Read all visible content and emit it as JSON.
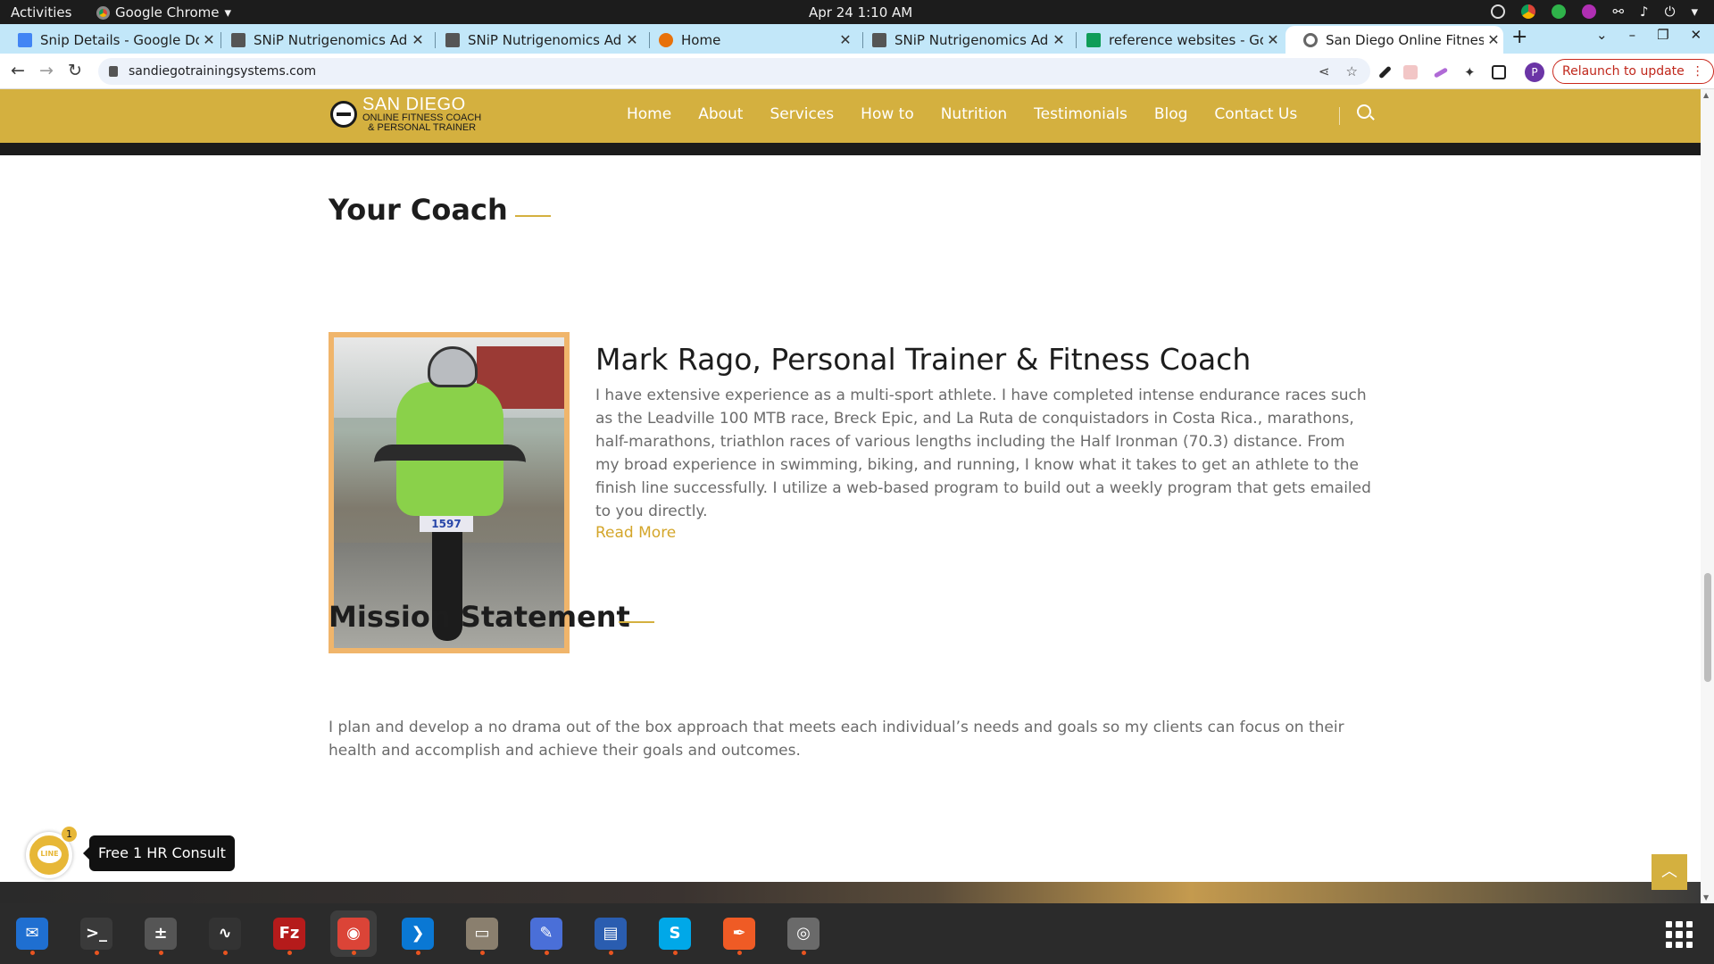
{
  "system": {
    "activities": "Activities",
    "app_name": "Google Chrome",
    "clock": "Apr 24  1:10 AM"
  },
  "tabs": [
    {
      "title": "Snip Details - Google Docs",
      "color": "#4285f4"
    },
    {
      "title": "SNiP Nutrigenomics Admin",
      "color": "#555555"
    },
    {
      "title": "SNiP Nutrigenomics Admin",
      "color": "#555555"
    },
    {
      "title": "Home",
      "color": "#e8710a"
    },
    {
      "title": "SNiP Nutrigenomics Admin",
      "color": "#555555"
    },
    {
      "title": "reference websites - Google Sheets",
      "color": "#0f9d58"
    },
    {
      "title": "San Diego Online Fitness",
      "color": "#666666"
    }
  ],
  "toolbar": {
    "url": "sandiegotrainingsystems.com",
    "relaunch": "Relaunch to update",
    "profile_initial": "P"
  },
  "site": {
    "logo_big": "SAN DIEGO",
    "logo_small_1": "ONLINE FITNESS COACH",
    "logo_small_2": "& PERSONAL TRAINER",
    "nav": [
      "Home",
      "About",
      "Services",
      "How to",
      "Nutrition",
      "Testimonials",
      "Blog",
      "Contact Us"
    ],
    "accent": "#d4b03f"
  },
  "coach": {
    "section_title": "Your Coach",
    "name": "Mark Rago, Personal Trainer & Fitness Coach",
    "bio": "I have extensive experience as a multi-sport athlete. I have completed intense endurance races such as the Leadville 100 MTB race, Breck Epic, and La Ruta de conquistadors in Costa Rica., marathons, half-marathons, triathlon races of various lengths including the Half Ironman (70.3) distance. From my broad experience in swimming, biking, and running, I know what it takes to get an athlete to the finish line successfully. I utilize a web-based program to build out a weekly program that gets emailed to you directly.",
    "read_more": "Read More",
    "bib_number": "1597"
  },
  "mission": {
    "section_title": "Mission Statement",
    "text": "I plan and develop a no drama out of the box approach that meets each individual’s needs and goals so my clients can focus on their health and accomplish and achieve their goals and outcomes."
  },
  "widget": {
    "line_label": "LINE",
    "badge": "1",
    "consult": "Free 1 HR Consult"
  },
  "dock": [
    {
      "name": "thunderbird-icon",
      "color": "#1f6fd1",
      "glyph": "✉"
    },
    {
      "name": "terminal-icon",
      "color": "#3a3a3a",
      "glyph": ">_"
    },
    {
      "name": "calculator-icon",
      "color": "#555555",
      "glyph": "±"
    },
    {
      "name": "system-monitor-icon",
      "color": "#333333",
      "glyph": "∿"
    },
    {
      "name": "filezilla-icon",
      "color": "#b51b1b",
      "glyph": "Fz"
    },
    {
      "name": "chrome-icon",
      "color": "#db4437",
      "glyph": "◉"
    },
    {
      "name": "vscode-icon",
      "color": "#0a78d4",
      "glyph": "❯"
    },
    {
      "name": "files-icon",
      "color": "#8a7f6e",
      "glyph": "▭"
    },
    {
      "name": "text-editor-icon",
      "color": "#4a6fd8",
      "glyph": "✎"
    },
    {
      "name": "document-viewer-icon",
      "color": "#2a5db0",
      "glyph": "▤"
    },
    {
      "name": "skype-icon",
      "color": "#00a8e8",
      "glyph": "S"
    },
    {
      "name": "postman-icon",
      "color": "#ef5b25",
      "glyph": "✒"
    },
    {
      "name": "disk-utility-icon",
      "color": "#6a6a6a",
      "glyph": "◎"
    }
  ]
}
